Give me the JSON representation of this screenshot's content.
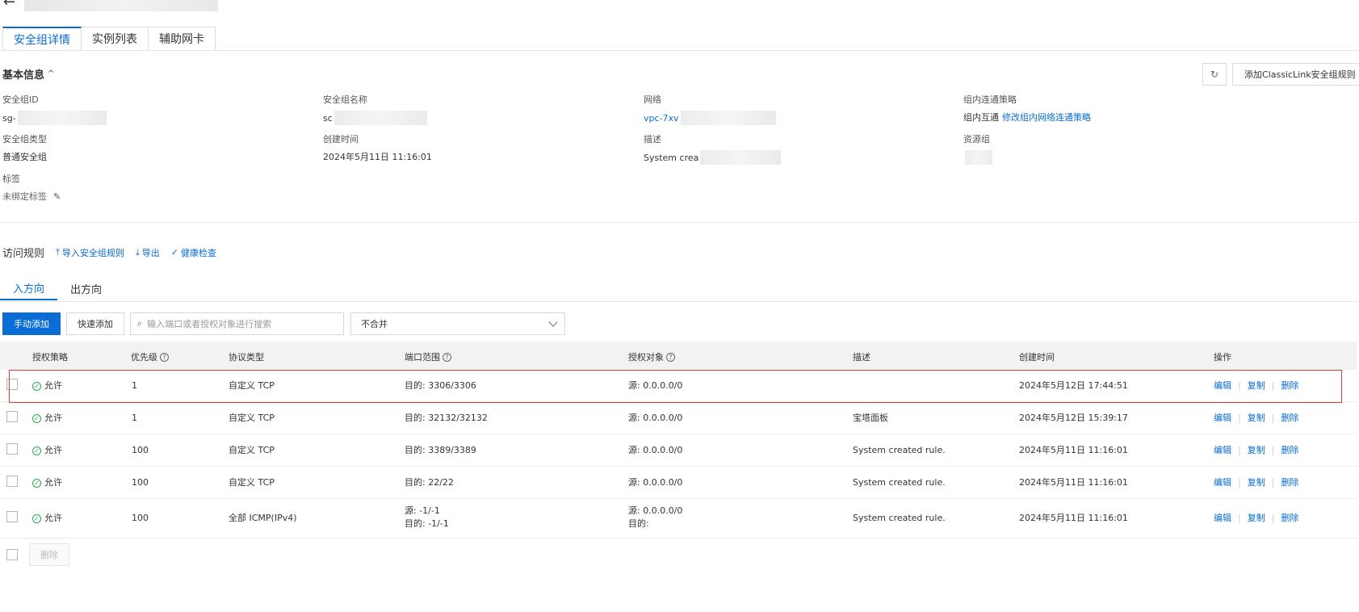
{
  "header": {
    "back_icon": "arrow-left-icon"
  },
  "tabs": [
    {
      "label": "安全组详情",
      "active": true
    },
    {
      "label": "实例列表",
      "active": false
    },
    {
      "label": "辅助网卡",
      "active": false
    }
  ],
  "basic_info": {
    "title": "基本信息",
    "refresh_icon": "refresh-icon",
    "classiclink_button": "添加ClassicLink安全组规则",
    "items": {
      "sg_id": {
        "label": "安全组ID",
        "value": "sg-"
      },
      "sg_name": {
        "label": "安全组名称",
        "value": "sc"
      },
      "network": {
        "label": "网络",
        "value": "vpc-7xv"
      },
      "intra": {
        "label": "组内连通策略",
        "value": "组内互通",
        "link": "修改组内网络连通策略"
      },
      "sg_type": {
        "label": "安全组类型",
        "value": "普通安全组"
      },
      "created": {
        "label": "创建时间",
        "value": "2024年5月11日 11:16:01"
      },
      "desc": {
        "label": "描述",
        "value": "System crea"
      },
      "resource_group": {
        "label": "资源组",
        "value": ""
      },
      "tags": {
        "label": "标签",
        "value": "未绑定标签"
      }
    }
  },
  "rules": {
    "title": "访问规则",
    "import_label": "导入安全组规则",
    "export_label": "导出",
    "health_label": "健康检查",
    "direction_tabs": [
      {
        "label": "入方向",
        "active": true
      },
      {
        "label": "出方向",
        "active": false
      }
    ],
    "manual_add": "手动添加",
    "quick_add": "快速添加",
    "search_placeholder": "输入端口或者授权对象进行搜索",
    "merge_select": "不合并",
    "columns": [
      "授权策略",
      "优先级",
      "协议类型",
      "端口范围",
      "授权对象",
      "描述",
      "创建时间",
      "操作"
    ],
    "rows": [
      {
        "policy": "允许",
        "priority": "1",
        "protocol": "自定义 TCP",
        "port": "目的: 3306/3306",
        "port2": "",
        "auth": "源: 0.0.0.0/0",
        "auth2": "",
        "desc": "",
        "created": "2024年5月12日 17:44:51"
      },
      {
        "policy": "允许",
        "priority": "1",
        "protocol": "自定义 TCP",
        "port": "目的: 32132/32132",
        "port2": "",
        "auth": "源: 0.0.0.0/0",
        "auth2": "",
        "desc": "宝塔面板",
        "created": "2024年5月12日 15:39:17"
      },
      {
        "policy": "允许",
        "priority": "100",
        "protocol": "自定义 TCP",
        "port": "目的: 3389/3389",
        "port2": "",
        "auth": "源: 0.0.0.0/0",
        "auth2": "",
        "desc": "System created rule.",
        "created": "2024年5月11日 11:16:01"
      },
      {
        "policy": "允许",
        "priority": "100",
        "protocol": "自定义 TCP",
        "port": "目的: 22/22",
        "port2": "",
        "auth": "源: 0.0.0.0/0",
        "auth2": "",
        "desc": "System created rule.",
        "created": "2024年5月11日 11:16:01"
      },
      {
        "policy": "允许",
        "priority": "100",
        "protocol": "全部 ICMP(IPv4)",
        "port": "源: -1/-1",
        "port2": "目的: -1/-1",
        "auth": "源: 0.0.0.0/0",
        "auth2": "目的:",
        "desc": "System created rule.",
        "created": "2024年5月11日 11:16:01"
      }
    ],
    "ops": {
      "edit": "编辑",
      "copy": "复制",
      "delete": "删除"
    },
    "bulk_delete": "删除"
  }
}
